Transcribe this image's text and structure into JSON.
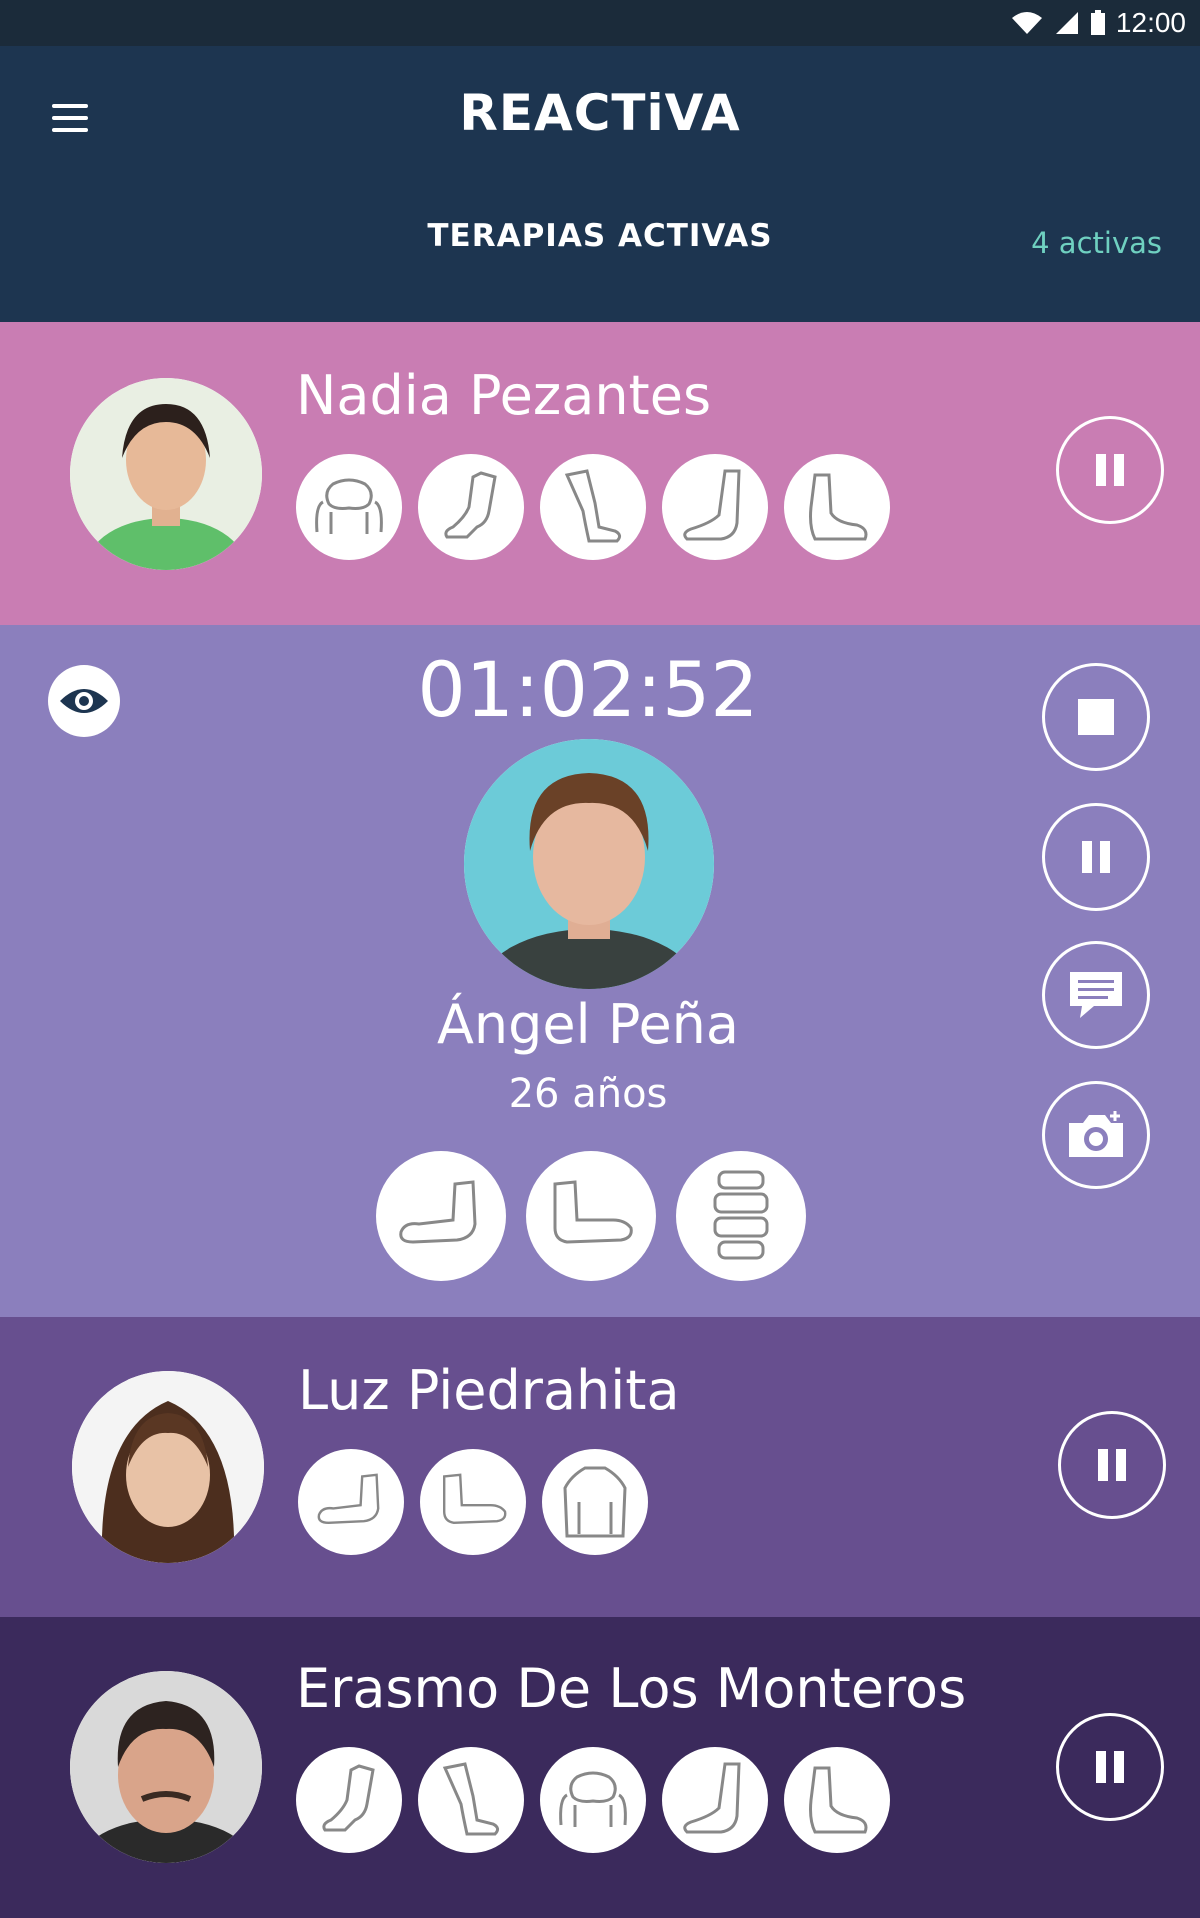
{
  "status_bar": {
    "time": "12:00"
  },
  "header": {
    "logo": "REACTiVA",
    "title": "TERAPIAS ACTIVAS",
    "active_count": "4 activas"
  },
  "patients": [
    {
      "name": "Nadia Pezantes",
      "body_parts": [
        "shoulders-icon",
        "knee-icon",
        "leg-icon",
        "ankle-icon",
        "foot-icon"
      ],
      "control": "pause"
    },
    {
      "timer": "01:02:52",
      "name": "Ángel Peña",
      "age": "26 años",
      "body_parts": [
        "elbow-icon",
        "arm-icon",
        "spine-icon"
      ],
      "controls": [
        "stop",
        "pause",
        "message",
        "camera"
      ]
    },
    {
      "name": "Luz Piedrahita",
      "body_parts": [
        "elbow-icon",
        "arm-icon",
        "back-icon"
      ],
      "control": "pause"
    },
    {
      "name": "Erasmo De Los Monteros",
      "body_parts": [
        "knee-icon",
        "leg-icon",
        "shoulders-icon",
        "ankle-icon",
        "foot-icon"
      ],
      "control": "pause"
    }
  ],
  "colors": {
    "header_bg": "#1d3550",
    "card1": "#c97db3",
    "card2": "#8b7fbd",
    "card3": "#674f8f",
    "card4": "#3b2a5c",
    "accent": "#6fd0c0"
  }
}
